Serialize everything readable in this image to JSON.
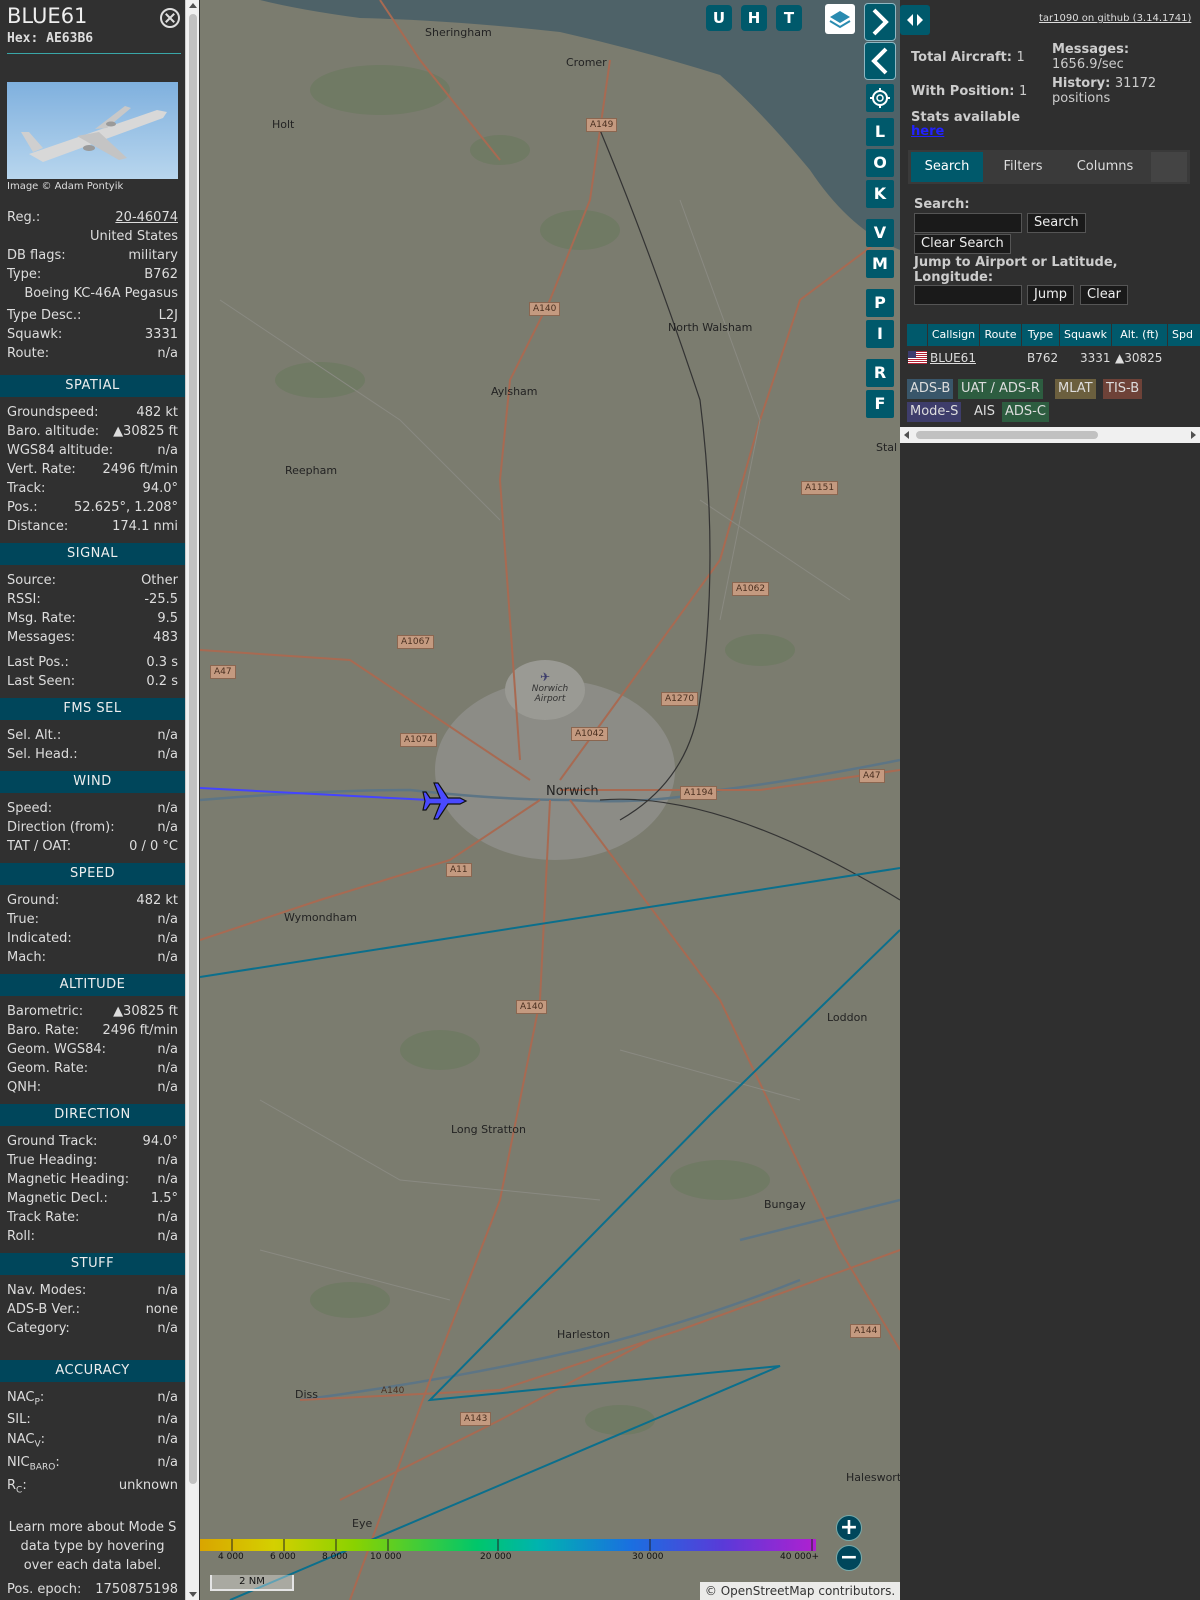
{
  "aircraft": {
    "callsign": "BLUE61",
    "hex_label": "Hex:",
    "hex": "AE63B6",
    "photo_credit": "Image © Adam Pontyik"
  },
  "details": {
    "reg_label": "Reg.:",
    "reg": "20-46074",
    "country": "United States",
    "dbflags_label": "DB flags:",
    "dbflags": "military",
    "type_label": "Type:",
    "type": "B762",
    "type_name": "Boeing KC-46A Pegasus",
    "typedesc_label": "Type Desc.:",
    "typedesc": "L2J",
    "squawk_label": "Squawk:",
    "squawk": "3331",
    "route_label": "Route:",
    "route": "n/a"
  },
  "sections": {
    "spatial": "SPATIAL",
    "signal": "SIGNAL",
    "fms": "FMS SEL",
    "wind": "WIND",
    "speed": "SPEED",
    "altitude": "ALTITUDE",
    "direction": "DIRECTION",
    "stuff": "STUFF",
    "accuracy": "ACCURACY"
  },
  "spatial": {
    "gs_label": "Groundspeed:",
    "gs": "482 kt",
    "baro_label": "Baro. altitude:",
    "baro": "▲30825 ft",
    "wgs_label": "WGS84 altitude:",
    "wgs": "n/a",
    "vr_label": "Vert. Rate:",
    "vr": "2496 ft/min",
    "track_label": "Track:",
    "track": "94.0°",
    "pos_label": "Pos.:",
    "pos": "52.625°, 1.208°",
    "dist_label": "Distance:",
    "dist": "174.1 nmi"
  },
  "signal": {
    "source_label": "Source:",
    "source": "Other",
    "rssi_label": "RSSI:",
    "rssi": "-25.5",
    "msgrate_label": "Msg. Rate:",
    "msgrate": "9.5",
    "messages_label": "Messages:",
    "messages": "483",
    "lastpos_label": "Last Pos.:",
    "lastpos": "0.3 s",
    "lastseen_label": "Last Seen:",
    "lastseen": "0.2 s"
  },
  "fms": {
    "selalt_label": "Sel. Alt.:",
    "selalt": "n/a",
    "selhead_label": "Sel. Head.:",
    "selhead": "n/a"
  },
  "wind": {
    "speed_label": "Speed:",
    "speed": "n/a",
    "dir_label": "Direction (from):",
    "dir": "n/a",
    "tat_label": "TAT / OAT:",
    "tat": "0 / 0 °C"
  },
  "speed": {
    "ground_label": "Ground:",
    "ground": "482 kt",
    "true_label": "True:",
    "true": "n/a",
    "ind_label": "Indicated:",
    "ind": "n/a",
    "mach_label": "Mach:",
    "mach": "n/a"
  },
  "altitude": {
    "baro_label": "Barometric:",
    "baro": "▲30825 ft",
    "barorate_label": "Baro. Rate:",
    "barorate": "2496 ft/min",
    "geom_label": "Geom. WGS84:",
    "geom": "n/a",
    "geomrate_label": "Geom. Rate:",
    "geomrate": "n/a",
    "qnh_label": "QNH:",
    "qnh": "n/a"
  },
  "direction": {
    "gtrack_label": "Ground Track:",
    "gtrack": "94.0°",
    "thead_label": "True Heading:",
    "thead": "n/a",
    "mhead_label": "Magnetic Heading:",
    "mhead": "n/a",
    "mdecl_label": "Magnetic Decl.:",
    "mdecl": "1.5°",
    "trate_label": "Track Rate:",
    "trate": "n/a",
    "roll_label": "Roll:",
    "roll": "n/a"
  },
  "stuff": {
    "nav_label": "Nav. Modes:",
    "nav": "n/a",
    "adsb_label": "ADS-B Ver.:",
    "adsb": "none",
    "cat_label": "Category:",
    "cat": "n/a"
  },
  "accuracy": {
    "nacp_label": "NAC",
    "nacp_sub": "P",
    "nacp": "n/a",
    "sil_label": "SIL:",
    "sil": "n/a",
    "nacv_label": "NAC",
    "nacv_sub": "V",
    "nacv": "n/a",
    "nic_label": "NIC",
    "nic_sub": "BARO",
    "nic": "n/a",
    "rc_label": "R",
    "rc_sub": "C",
    "rc": "unknown"
  },
  "footer": {
    "note": "Learn more about Mode S data type by hovering over each data label.",
    "epoch_label": "Pos. epoch:",
    "epoch": "1750875198"
  },
  "map": {
    "toolbar": [
      "U",
      "H",
      "T"
    ],
    "side_buttons": [
      "L",
      "O",
      "K",
      "V",
      "M",
      "P",
      "I",
      "R",
      "F"
    ],
    "places": {
      "sheringham": "Sheringham",
      "cromer": "Cromer",
      "holt": "Holt",
      "north_walsham": "North Walsham",
      "aylsham": "Aylsham",
      "reepham": "Reepham",
      "stalham": "Stal",
      "norwich_airport": "Norwich Airport",
      "norwich": "Norwich",
      "wymondham": "Wymondham",
      "loddon": "Loddon",
      "long_stratton": "Long Stratton",
      "bungay": "Bungay",
      "harleston": "Harleston",
      "diss": "Diss",
      "halesworth": "Haleswort",
      "eye": "Eye"
    },
    "roads": {
      "a149": "A149",
      "a140n": "A140",
      "a1151": "A1151",
      "a1062": "A1062",
      "a1067": "A1067",
      "a47w": "A47",
      "a1270": "A1270",
      "a1042": "A1042",
      "a1074": "A1074",
      "a1194": "A1194",
      "a47e": "A47",
      "a11": "A11",
      "a140s": "A140",
      "a144": "A144",
      "a140d": "A140",
      "a143": "A143"
    },
    "legend": [
      "4 000",
      "6 000",
      "8 000",
      "10 000",
      "20 000",
      "30 000",
      "40 000+"
    ],
    "scale": "2 NM",
    "attribution_prefix": "© ",
    "attribution_link": "OpenStreetMap",
    "attribution_suffix": " contributors."
  },
  "right": {
    "github": "tar1090 on github (3.14.1741)",
    "total_label": "Total Aircraft:",
    "total": "1",
    "withpos_label": "With Position:",
    "withpos": "1",
    "messages_label": "Messages:",
    "messages": "1656.9/sec",
    "history_label": "History:",
    "history": "31172",
    "history_unit": "positions",
    "stats_label": "Stats available",
    "stats_link": "here",
    "tabs": [
      "Search",
      "Filters",
      "Columns"
    ],
    "search_label": "Search:",
    "search_value": "",
    "search_button": "Search",
    "clear_search_button": "Clear Search",
    "jump_label": "Jump to Airport or Latitude, Longitude:",
    "jump_value": "",
    "jump_button": "Jump",
    "clear_button": "Clear",
    "table": {
      "headers": [
        "Callsign",
        "Route",
        "Type",
        "Squawk",
        "Alt. (ft)",
        "Spd"
      ],
      "row": {
        "callsign": "BLUE61",
        "route": "",
        "type": "B762",
        "squawk": "3331",
        "alt": "▲30825"
      }
    },
    "sources": [
      "ADS-B",
      "UAT / ADS-R",
      "MLAT",
      "TIS-B",
      "Mode-S",
      "AIS",
      "ADS-C"
    ]
  },
  "colors": {
    "panel_bg": "#303030",
    "section_header": "#00465b",
    "accent_button": "#00596b",
    "track_line": "#4444ff",
    "history_track": "#0b6f8c"
  }
}
